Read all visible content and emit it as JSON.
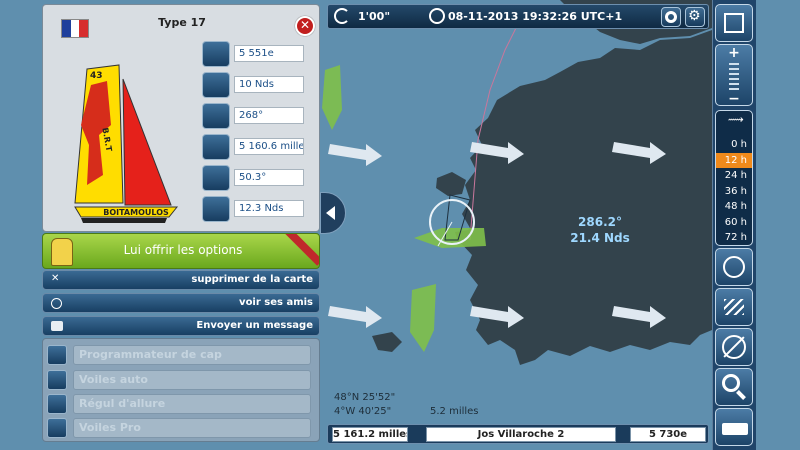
{
  "colors": {
    "accent": "#f08a1b",
    "land": "#33434c",
    "sea": "#5f8fae",
    "panel": "#d8dde2",
    "promo": "#7cb52a"
  },
  "topbar": {
    "refresh_interval": "1'00\"",
    "datetime": "08-11-2013 19:32:26 UTC+1",
    "icons": [
      "refresh-icon",
      "clock-icon",
      "lifebuoy-icon",
      "settings-icon"
    ]
  },
  "map": {
    "wind": {
      "direction": "286.2°",
      "speed": "21.4 Nds"
    },
    "coords": {
      "lat": "48°N 25'52\"",
      "lon": "4°W 40'25\""
    },
    "scale": "5.2 milles"
  },
  "boat": {
    "title": "Type 17",
    "sail_number": "43",
    "boat_name": "BOITAMOULOS",
    "hull_marking": "B.R.T",
    "stats": [
      {
        "icon": "boat-icon",
        "value": "5 551e"
      },
      {
        "icon": "boat-speed-icon",
        "value": "10 Nds"
      },
      {
        "icon": "compass-icon",
        "value": "268°"
      },
      {
        "icon": "distance-icon",
        "value": "5 160.6 mille"
      },
      {
        "icon": "wind-angle-icon",
        "value": "50.3°"
      },
      {
        "icon": "windsock-icon",
        "value": "12.3 Nds"
      }
    ]
  },
  "promo": {
    "label": "Lui offrir les options"
  },
  "actions": {
    "remove": "supprimer de la carte",
    "friends": "voir ses amis",
    "message": "Envoyer un message"
  },
  "autopilots": [
    {
      "icon": "compass-icon",
      "label": "Programmateur de cap"
    },
    {
      "icon": "sails-icon",
      "label": "Voiles auto"
    },
    {
      "icon": "wind-angle-icon",
      "label": "Régul d'allure"
    },
    {
      "icon": "pro-sails-icon",
      "label": "Voiles Pro"
    }
  ],
  "forecast_hours": {
    "options": [
      "0 h",
      "12 h",
      "24 h",
      "36 h",
      "48 h",
      "60 h",
      "72 h"
    ],
    "selected": "12 h"
  },
  "bottombar": {
    "distance": "5 161.2 milles",
    "skipper": "Jos Villaroche 2",
    "rank": "5 730e"
  }
}
